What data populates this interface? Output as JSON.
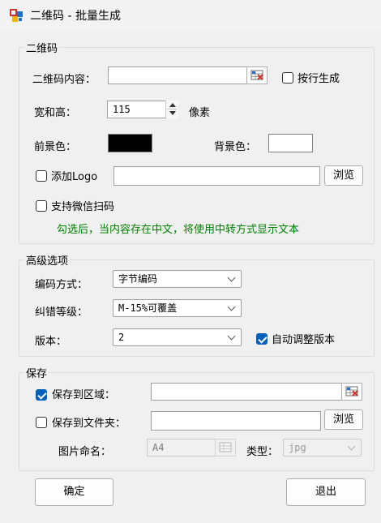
{
  "window": {
    "title": "二维码 - 批量生成"
  },
  "qrcode_group": {
    "title": "二维码",
    "content_label": "二维码内容：",
    "content_value": "",
    "per_line_label": "按行生成",
    "per_line_checked": false,
    "size_label": "宽和高：",
    "size_value": "115",
    "size_unit": "像素",
    "fg_label": "前景色：",
    "fg_color": "#000000",
    "bg_label": "背景色：",
    "bg_color": "#ffffff",
    "logo_label": "添加Logo",
    "logo_checked": false,
    "logo_path": "",
    "browse_label": "浏览",
    "wechat_label": "支持微信扫码",
    "wechat_checked": false,
    "wechat_hint": "勾选后，当内容存在中文，将使用中转方式显示文本"
  },
  "advanced_group": {
    "title": "高级选项",
    "encoding_label": "编码方式：",
    "encoding_value": "字节编码",
    "ecc_label": "纠错等级：",
    "ecc_value": "M-15%可覆盖",
    "version_label": "版本：",
    "version_value": "2",
    "auto_version_label": "自动调整版本",
    "auto_version_checked": true
  },
  "save_group": {
    "title": "保存",
    "to_area_label": "保存到区域：",
    "to_area_checked": true,
    "area_value": "",
    "to_folder_label": "保存到文件夹：",
    "to_folder_checked": false,
    "folder_value": "",
    "browse_label": "浏览",
    "naming_label": "图片命名：",
    "naming_value": "A4",
    "type_label": "类型：",
    "type_value": "jpg"
  },
  "footer": {
    "ok_label": "确定",
    "exit_label": "退出"
  },
  "colors": {
    "accent": "#005fb8",
    "hint": "#008000",
    "icon_red": "#d0312d",
    "icon_blue": "#1f6fd1",
    "icon_yellow": "#f2b705"
  }
}
